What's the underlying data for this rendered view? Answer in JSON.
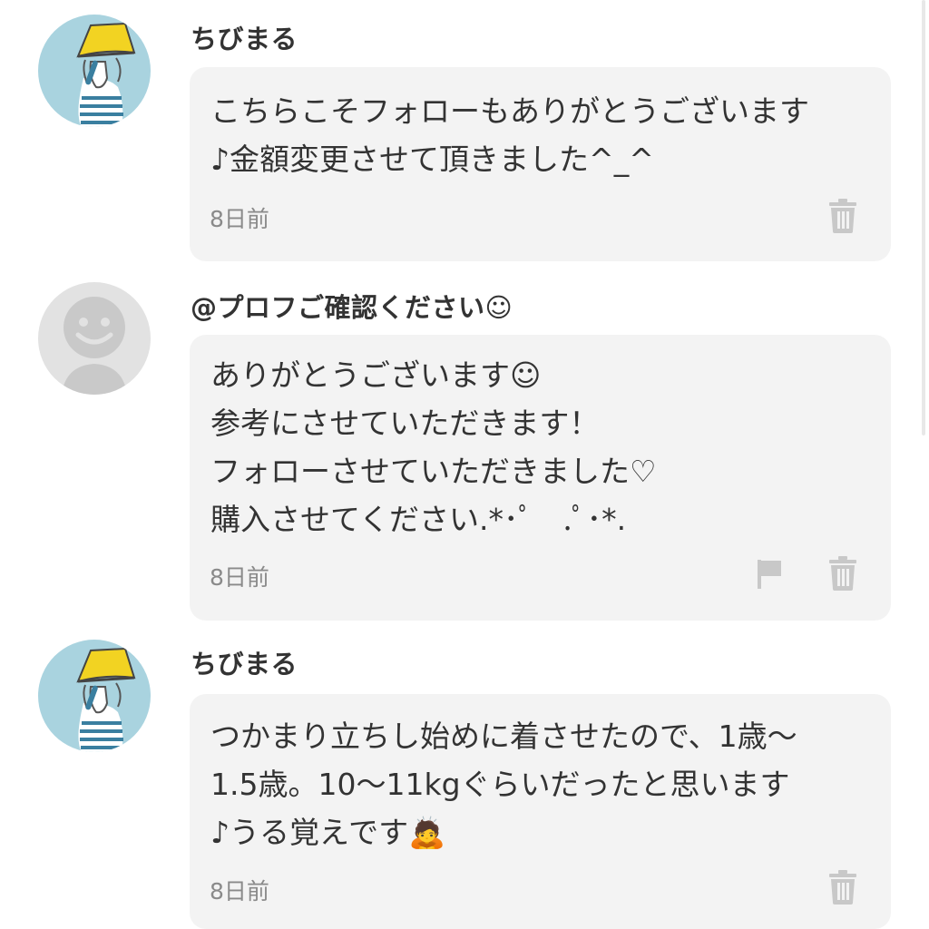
{
  "comments": [
    {
      "author": "ちびまる",
      "avatar_icon": "yellow-bucket-hat-avatar-icon",
      "lines": [
        "こちらこそフォローもありがとうございます",
        "♪金額変更させて頂きました^_^"
      ],
      "time": "8日前",
      "actions": [
        "trash-icon"
      ]
    },
    {
      "author": "@プロフご確認ください☺",
      "avatar_icon": "default-user-avatar-icon",
      "lines": [
        "ありがとうございます☺",
        "参考にさせていただきます！",
        "フォローさせていただきました♡",
        "購入させてください.*･ﾟ　.ﾟ･*."
      ],
      "time": "8日前",
      "actions": [
        "flag-icon",
        "trash-icon"
      ]
    },
    {
      "author": "ちびまる",
      "avatar_icon": "yellow-bucket-hat-avatar-icon",
      "lines": [
        "つかまり立ちし始めに着させたので、1歳〜",
        "1.5歳。10〜11kgぐらいだったと思います",
        "♪うる覚えです🙇"
      ],
      "time": "8日前",
      "actions": [
        "trash-icon"
      ]
    }
  ],
  "colors": {
    "bubble_bg": "#f3f3f3",
    "avatar_bg": "#a9d3df",
    "hat": "#f2d322",
    "default_avatar_bg": "#e2e2e2",
    "icon_gray": "#c8c8c8"
  }
}
